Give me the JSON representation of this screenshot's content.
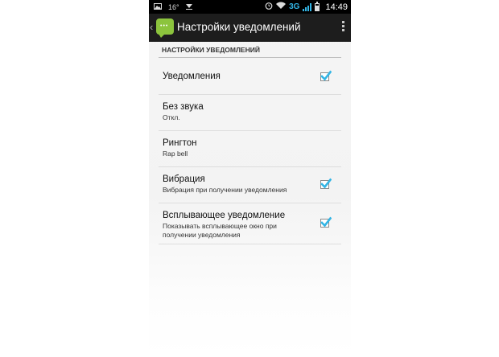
{
  "status_bar": {
    "notification_icon": "image-icon",
    "temperature": "16°",
    "download_icon": "download-icon",
    "alarm_icon": "alarm-icon",
    "wifi_icon": "wifi-icon",
    "network": "3G",
    "battery_icon": "battery-icon",
    "time": "14:49"
  },
  "action_bar": {
    "title": "Настройки уведомлений",
    "icon": "messaging-app-icon",
    "menu_icon": "overflow-menu-icon"
  },
  "section": {
    "title": "НАСТРОЙКИ УВЕДОМЛЕНИЙ"
  },
  "prefs": [
    {
      "title": "Уведомления",
      "summary": "",
      "checked": true
    },
    {
      "title": "Без звука",
      "summary": "Откл."
    },
    {
      "title": "Рингтон",
      "summary": "Rap bell"
    },
    {
      "title": "Вибрация",
      "summary": "Вибрация при получении уведомления",
      "checked": true
    },
    {
      "title": "Всплывающее уведомление",
      "summary": "Показывать всплывающее окно при получении уведомления",
      "checked": true
    }
  ],
  "colors": {
    "accent": "#33b5e5",
    "app_icon": "#8cc43d",
    "action_bar": "#1d1d1d"
  }
}
